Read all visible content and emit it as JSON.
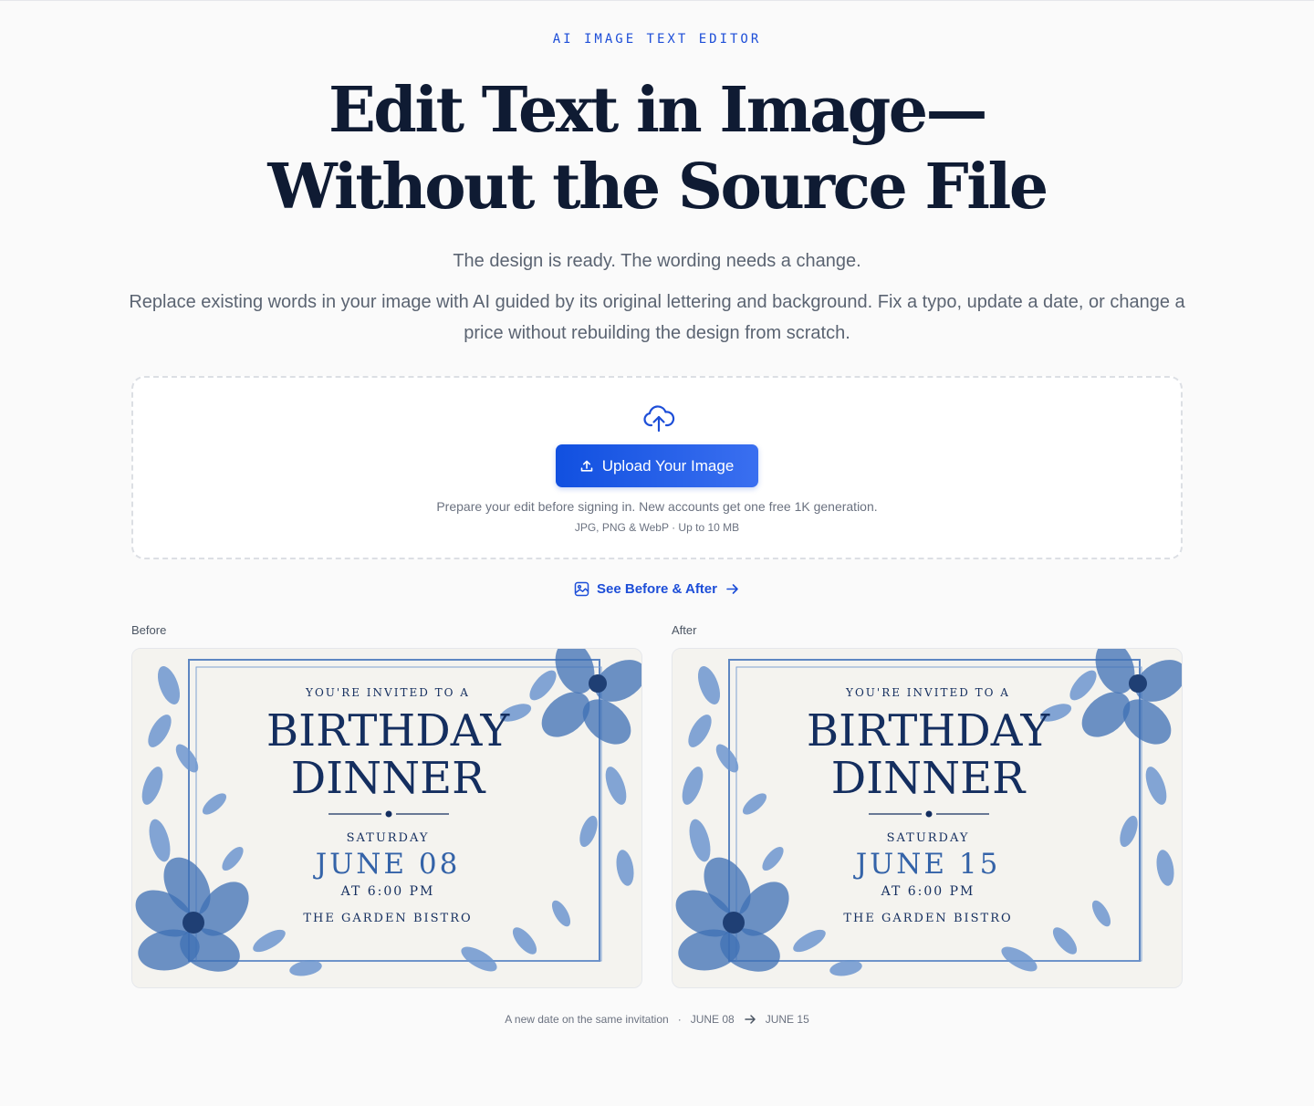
{
  "hero": {
    "eyebrow": "AI IMAGE TEXT EDITOR",
    "headline_line1": "Edit Text in Image—",
    "headline_line2": "Without the Source File",
    "tagline": "The design is ready. The wording needs a change.",
    "description": "Replace existing words in your image with AI guided by its original lettering and background. Fix a typo, update a date, or change a price without rebuilding the design from scratch."
  },
  "upload": {
    "button_label": "Upload Your Image",
    "note": "Prepare your edit before signing in. New accounts get one free 1K generation.",
    "formats": "JPG, PNG & WebP · Up to 10 MB",
    "icons": {
      "cloud": "cloud-upload-icon",
      "button": "upload-icon"
    }
  },
  "see_link": {
    "label": "See Before & After",
    "icons": {
      "leading": "image-icon",
      "trailing": "arrow-right-icon"
    }
  },
  "comparison": {
    "before_label": "Before",
    "after_label": "After",
    "before": {
      "pre": "YOU'RE INVITED TO A",
      "title1": "BIRTHDAY",
      "title2": "DINNER",
      "day": "SATURDAY",
      "date": "JUNE 08",
      "time": "AT 6:00 PM",
      "venue": "THE GARDEN BISTRO"
    },
    "after": {
      "pre": "YOU'RE INVITED TO A",
      "title1": "BIRTHDAY",
      "title2": "DINNER",
      "day": "SATURDAY",
      "date": "JUNE 15",
      "time": "AT 6:00 PM",
      "venue": "THE GARDEN BISTRO"
    }
  },
  "caption": {
    "text": "A new date on the same invitation",
    "separator": "·",
    "from": "JUNE 08",
    "to": "JUNE 15"
  },
  "colors": {
    "accent": "#1d4ed8",
    "headline": "#0f1b33",
    "invite_ink": "#142e5f",
    "invite_date": "#3463a8",
    "flower": "#4d7fc0"
  }
}
